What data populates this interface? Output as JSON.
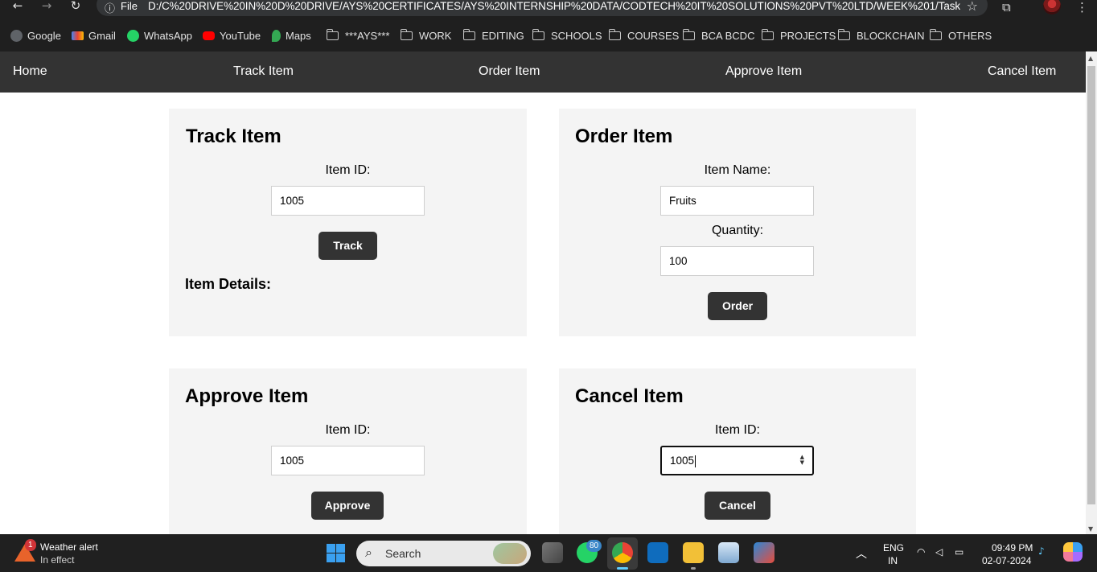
{
  "browser": {
    "info_label": "File",
    "url": "D:/C%20DRIVE%20IN%20D%20DRIVE/AYS%20CERTIFICATES/AYS%20INTERNSHIP%20DATA/CODTECH%20IT%20SOLUTIONS%20PVT%20LTD/WEEK%201/Task%2...",
    "bookmarks": [
      "Google",
      "Gmail",
      "WhatsApp",
      "YouTube",
      "Maps",
      "***AYS***",
      "WORK",
      "EDITING",
      "SCHOOLS",
      "COURSES",
      "BCA BCDC",
      "PROJECTS",
      "BLOCKCHAIN",
      "OTHERS"
    ]
  },
  "nav": {
    "items": [
      "Home",
      "Track Item",
      "Order Item",
      "Approve Item",
      "Cancel Item"
    ]
  },
  "track": {
    "title": "Track Item",
    "id_label": "Item ID:",
    "id_value": "1005",
    "button": "Track",
    "details_heading": "Item Details:"
  },
  "order": {
    "title": "Order Item",
    "name_label": "Item Name:",
    "name_value": "Fruits",
    "qty_label": "Quantity:",
    "qty_value": "100",
    "button": "Order"
  },
  "approve": {
    "title": "Approve Item",
    "id_label": "Item ID:",
    "id_value": "1005",
    "button": "Approve"
  },
  "cancel": {
    "title": "Cancel Item",
    "id_label": "Item ID:",
    "id_value": "1005",
    "button": "Cancel"
  },
  "taskbar": {
    "weather_title": "Weather alert",
    "weather_sub": "In effect",
    "weather_badge": "1",
    "search_placeholder": "Search",
    "whatsapp_badge": "80",
    "lang_1": "ENG",
    "lang_2": "IN",
    "time": "09:49 PM",
    "date": "02-07-2024"
  },
  "colors": {
    "nav_bg": "#333333",
    "panel_bg": "#f4f4f4",
    "button_bg": "#333333"
  }
}
